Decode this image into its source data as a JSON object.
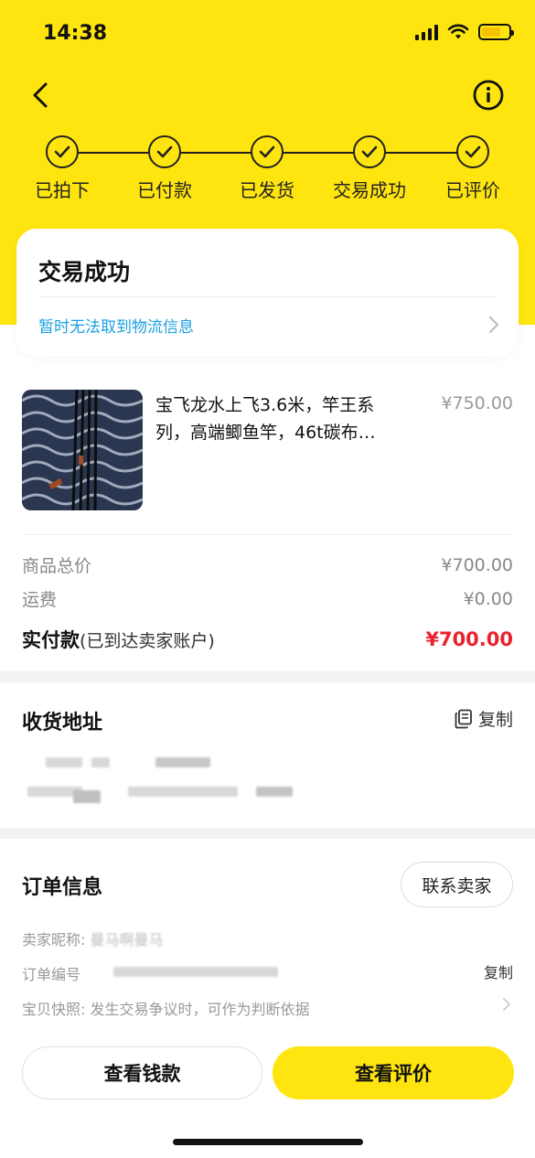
{
  "status_bar": {
    "time": "14:38"
  },
  "progress": {
    "steps": [
      "已拍下",
      "已付款",
      "已发货",
      "交易成功",
      "已评价"
    ]
  },
  "status_card": {
    "title": "交易成功",
    "logistics": "暂时无法取到物流信息"
  },
  "product": {
    "title": "宝飞龙水上飞3.6米，竿王系列，高端鲫鱼竿，46t碳布…",
    "price": "¥750.00"
  },
  "summary": {
    "total_label": "商品总价",
    "total_value": "¥700.00",
    "shipping_label": "运费",
    "shipping_value": "¥0.00",
    "paid_label": "实付款",
    "paid_note": "(已到达卖家账户)",
    "paid_value": "¥700.00"
  },
  "address": {
    "title": "收货地址",
    "copy_label": "复制"
  },
  "order_info": {
    "title": "订单信息",
    "contact_label": "联系卖家",
    "seller_label": "卖家昵称:",
    "seller_value": "曼马啊曼马",
    "order_no_label": "订单编号",
    "copy_label": "复制",
    "snapshot_label": "宝贝快照:",
    "snapshot_value": "发生交易争议时，可作为判断依据"
  },
  "actions": {
    "view_payment": "查看钱款",
    "view_review": "查看评价"
  },
  "colors": {
    "brand_yellow": "#FFE50F",
    "price_red": "#E8232E",
    "link_blue": "#1AA0E0"
  }
}
